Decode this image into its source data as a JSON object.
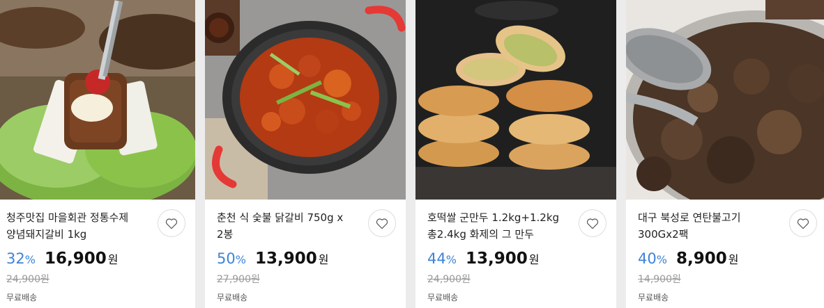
{
  "products": [
    {
      "title": "청주맛집 마을회관 정통수제 양념돼지갈비 1kg",
      "discount": "32",
      "pct": "%",
      "price": "16,900",
      "won": "원",
      "original": "24,900원",
      "shipping": "무료배송",
      "image": "grilled-pork-ribs-lettuce-wrap"
    },
    {
      "title": "춘천 식 숯불 닭갈비 750g x 2봉",
      "discount": "50",
      "pct": "%",
      "price": "13,900",
      "won": "원",
      "original": "27,900원",
      "shipping": "무료배송",
      "image": "spicy-chicken-pan"
    },
    {
      "title": "호떡쌀 군만두 1.2kg+1.2kg 총2.4kg 화제의 그 만두",
      "discount": "44",
      "pct": "%",
      "price": "13,900",
      "won": "원",
      "original": "24,900원",
      "shipping": "무료배송",
      "image": "stacked-pan-fried-dumplings"
    },
    {
      "title": "대구 북성로 연탄불고기 300Gx2팩",
      "discount": "40",
      "pct": "%",
      "price": "8,900",
      "won": "원",
      "original": "14,900원",
      "shipping": "무료배송",
      "image": "charcoal-bulgogi-pan"
    }
  ],
  "colors": {
    "discount": "#3d84d6",
    "price": "#111111",
    "original": "#999999"
  },
  "icons": {
    "wishlist": "heart-outline-icon"
  }
}
